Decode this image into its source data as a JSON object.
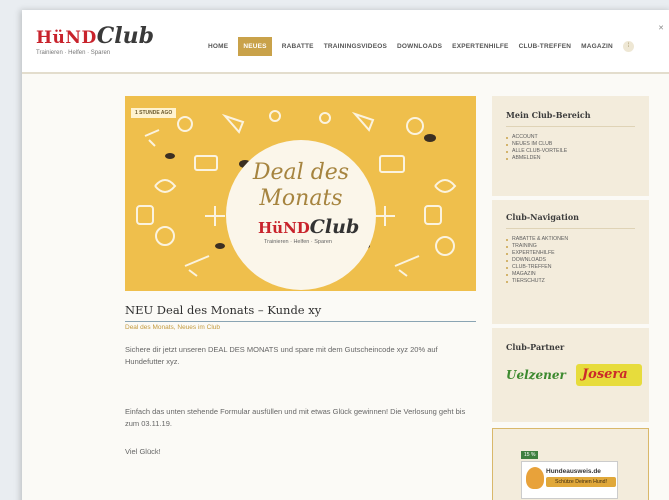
{
  "logo": {
    "word1": "HüND",
    "word2": "Club",
    "tagline": "Trainieren · Helfen · Sparen"
  },
  "nav": {
    "items": [
      "HOME",
      "NEUES",
      "RABATTE",
      "TRAININGSVIDEOS",
      "DOWNLOADS",
      "EXPERTENHILFE",
      "CLUB-TREFFEN",
      "MAGAZIN"
    ],
    "active_index": 1,
    "extra_icon": "more-icon"
  },
  "hero": {
    "badge": "1 STUNDE AGO",
    "title_line1": "Deal des",
    "title_line2": "Monats",
    "logo_word1": "HüND",
    "logo_word2": "Club",
    "logo_tagline": "Trainieren · Helfen · Sparen"
  },
  "post": {
    "title": "NEU Deal des Monats – Kunde xy",
    "meta": "Deal des Monats, Neues im Club",
    "p1": "Sichere dir jetzt unseren DEAL DES MONATS und spare mit dem Gutscheincode xyz 20% auf Hundefutter xyz.",
    "p2": "Einfach das unten stehende Formular ausfüllen und mit etwas Glück gewinnen! Die Verlosung geht bis zum 03.11.19.",
    "p3": "Viel Glück!"
  },
  "sidebar": {
    "club_area": {
      "title": "Mein Club-Bereich",
      "items": [
        "ACCOUNT",
        "NEUES IM CLUB",
        "ALLE CLUB-VORTEILE",
        "ABMELDEN"
      ]
    },
    "club_nav": {
      "title": "Club-Navigation",
      "items": [
        "RABATTE & AKTIONEN",
        "TRAINING",
        "EXPERTENHILFE",
        "DOWNLOADS",
        "CLUB-TREFFEN",
        "MAGAZIN",
        "TIERSCHUTZ"
      ]
    },
    "partners": {
      "title": "Club-Partner",
      "partner1": "Uelzener",
      "partner2": "Josera"
    },
    "ad": {
      "badge": "15 %",
      "name": "Hundeausweis.de",
      "slogan": "Schütze Deinen Hund!"
    }
  },
  "colors": {
    "accent": "#c9a24a",
    "hero_bg": "#efbf4c",
    "brand_red": "#c8232c"
  }
}
